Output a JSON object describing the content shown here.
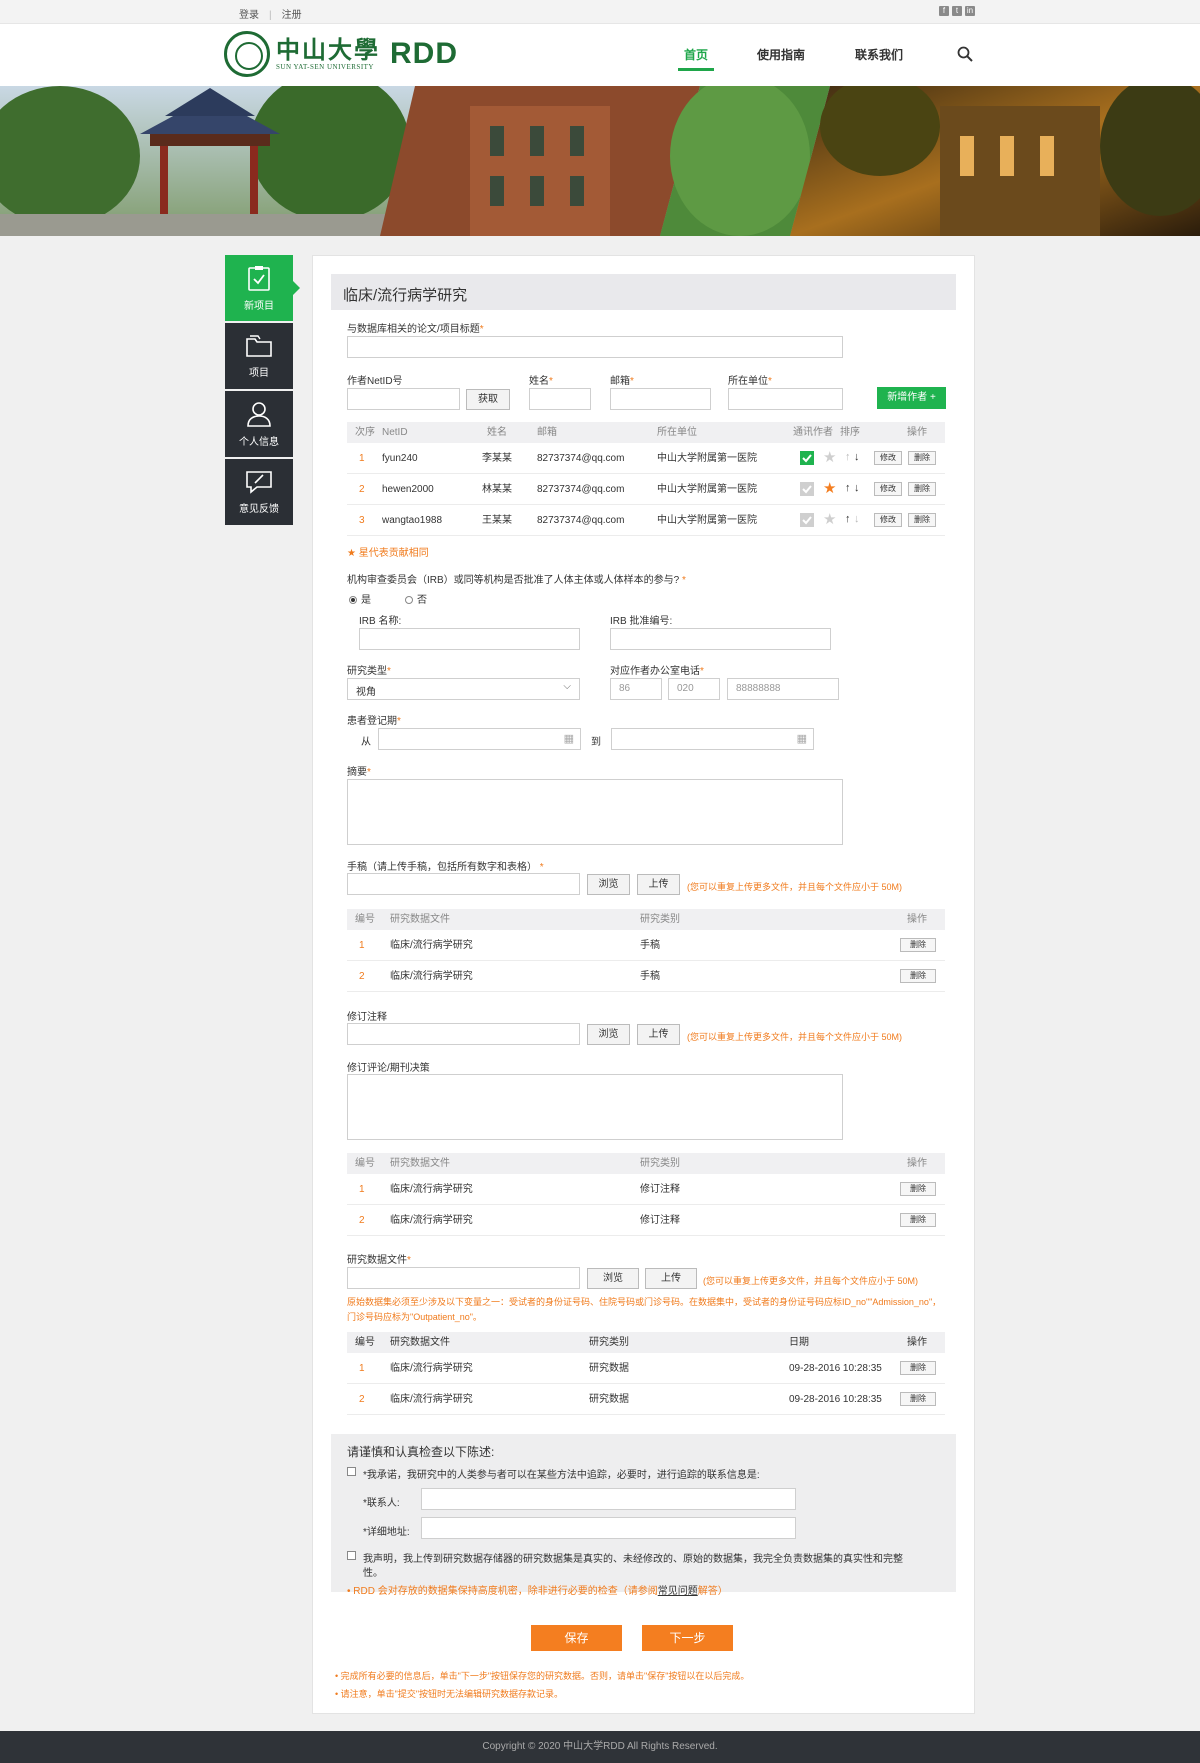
{
  "topbar": {
    "login": "登录",
    "register": "注册"
  },
  "header": {
    "logo_cn": "中山大學",
    "logo_en": "SUN YAT-SEN UNIVERSITY",
    "logo_rdd": "RDD",
    "nav": [
      "首页",
      "使用指南",
      "联系我们"
    ]
  },
  "sidebar": {
    "items": [
      "新项目",
      "项目",
      "个人信息",
      "意见反馈"
    ]
  },
  "form": {
    "title": "临床/流行病学研究",
    "paper_title_label": "与数据库相关的论文/项目标题",
    "author_netid_label": "作者NetID号",
    "fetch_button": "获取",
    "name_label": "姓名",
    "email_label": "邮箱",
    "unit_label": "所在单位",
    "add_author_button": "新增作者 +",
    "author_table": {
      "headers": [
        "次序",
        "NetID",
        "姓名",
        "邮箱",
        "所在单位",
        "通讯作者",
        "排序",
        "操作"
      ],
      "rows": [
        {
          "no": "1",
          "netid": "fyun240",
          "name": "李某某",
          "email": "82737374@qq.com",
          "unit": "中山大学附属第一医院"
        },
        {
          "no": "2",
          "netid": "hewen2000",
          "name": "林某某",
          "email": "82737374@qq.com",
          "unit": "中山大学附属第一医院"
        },
        {
          "no": "3",
          "netid": "wangtao1988",
          "name": "王某某",
          "email": "82737374@qq.com",
          "unit": "中山大学附属第一医院"
        }
      ],
      "edit": "修改",
      "delete": "删除"
    },
    "star_note": "星代表贡献相同",
    "irb_question": "机构审查委员会（IRB）或同等机构是否批准了人体主体或人体样本的参与?",
    "irb_yes": "是",
    "irb_no": "否",
    "irb_name_label": "IRB 名称:",
    "irb_number_label": "IRB 批准编号:",
    "study_type_label": "研究类型",
    "study_type_value": "视角",
    "phone_label": "对应作者办公室电话",
    "phone_country": "86",
    "phone_area": "020",
    "phone_number": "88888888",
    "registration_label": "患者登记期",
    "from_label": "从",
    "to_label": "到",
    "abstract_label": "摘要",
    "manuscript_label": "手稿（请上传手稿，包括所有数字和表格）",
    "browse": "浏览",
    "upload": "上传",
    "upload_note": "(您可以重复上传更多文件，并且每个文件应小于 50M)",
    "file_headers": [
      "编号",
      "研究数据文件",
      "研究类别",
      "操作"
    ],
    "manuscript_rows": [
      {
        "no": "1",
        "file": "临床/流行病学研究",
        "cat": "手稿"
      },
      {
        "no": "2",
        "file": "临床/流行病学研究",
        "cat": "手稿"
      }
    ],
    "revision_label": "修订注释",
    "revision_comment_label": "修订评论/期刊决策",
    "revision_rows": [
      {
        "no": "1",
        "file": "临床/流行病学研究",
        "cat": "修订注释"
      },
      {
        "no": "2",
        "file": "临床/流行病学研究",
        "cat": "修订注释"
      }
    ],
    "data_file_label": "研究数据文件",
    "data_note": "原始数据集必须至少涉及以下变量之一：受试者的身份证号码、住院号码或门诊号码。在数据集中，受试者的身份证号码应标ID_no\"\"Admission_no\"，门诊号码应标为\"Outpatient_no\"。",
    "data_headers": [
      "编号",
      "研究数据文件",
      "研究类别",
      "日期",
      "操作"
    ],
    "data_rows": [
      {
        "no": "1",
        "file": "临床/流行病学研究",
        "cat": "研究数据",
        "date": "09-28-2016 10:28:35"
      },
      {
        "no": "2",
        "file": "临床/流行病学研究",
        "cat": "研究数据",
        "date": "09-28-2016 10:28:35"
      }
    ],
    "decl_title": "请谨慎和认真检查以下陈述:",
    "decl_1": "*我承诺，我研究中的人类参与者可以在某些方法中追踪，必要时，进行追踪的联系信息是:",
    "contact_label": "*联系人:",
    "address_label": "*详细地址:",
    "decl_2a": "我声明，我上传到研究数据存储器的研究数据集是真实的、未经修改的、原始的数据集，我完全负责数据集的真实性和完整",
    "decl_2b": "性。",
    "decl_note_pre": "• RDD 会对存放的数据集保持高度机密，除非进行必要的检查（请参阅",
    "decl_note_link": "常见问题",
    "decl_note_post": "解答）",
    "save_button": "保存",
    "next_button": "下一步",
    "bottom_note_1": "• 完成所有必要的信息后，单击\"下一步\"按钮保存您的研究数据。否则，请单击\"保存\"按钮以在以后完成。",
    "bottom_note_2": "• 请注意，单击\"提交\"按钮时无法编辑研究数据存款记录。"
  },
  "footer": {
    "copyright": "Copyright © 2020 中山大学RDD All Rights Reserved."
  },
  "colors": {
    "accent_green": "#1fb34f",
    "orange": "#f47e20",
    "dark_sidebar": "#2b2f35"
  }
}
